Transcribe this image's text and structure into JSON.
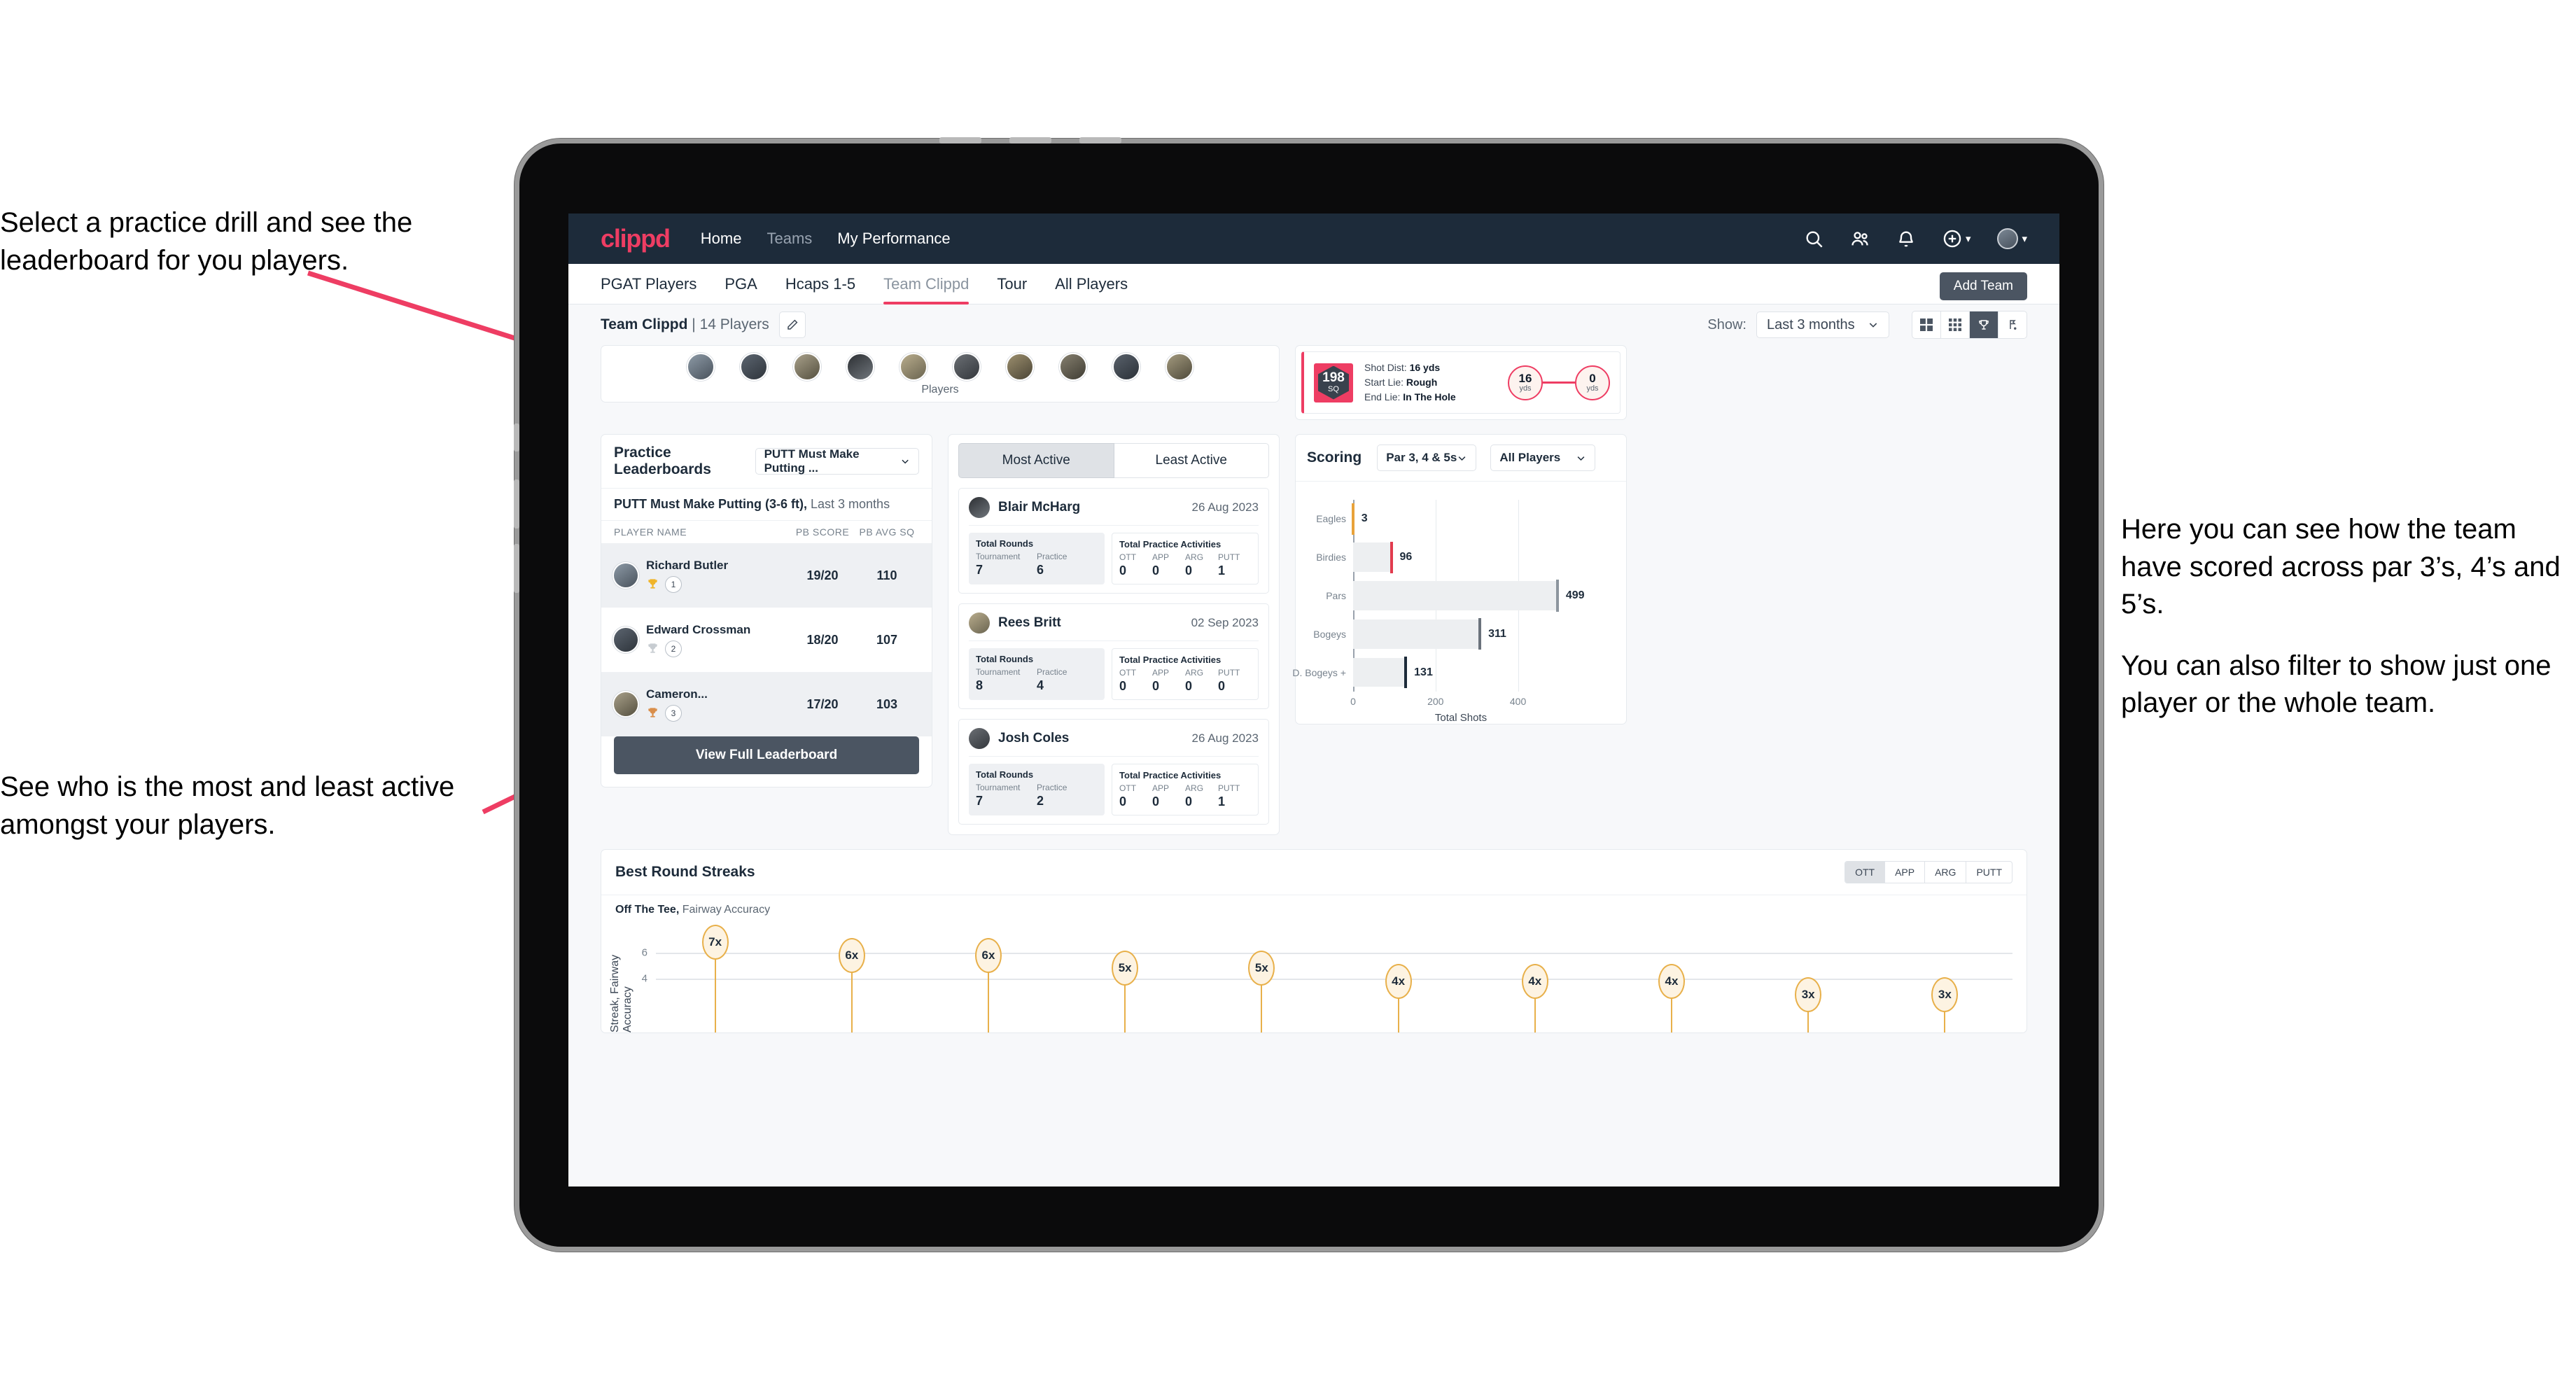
{
  "annotations": {
    "topleft": "Select a practice drill and see the leaderboard for you players.",
    "bottomleft": "See who is the most and least active amongst your players.",
    "right1": "Here you can see how the team have scored across par 3’s, 4’s and 5’s.",
    "right2": "You can also filter to show just one player or the whole team."
  },
  "nav": {
    "logo": "clippd",
    "links": [
      {
        "label": "Home",
        "dim": false
      },
      {
        "label": "Teams",
        "dim": true
      },
      {
        "label": "My Performance",
        "dim": false
      }
    ],
    "icons": [
      "search-icon",
      "people-icon",
      "bell-icon",
      "plus-circle-icon",
      "avatar"
    ]
  },
  "tabs": [
    {
      "label": "PGAT Players",
      "active": false,
      "dim": false
    },
    {
      "label": "PGA",
      "active": false,
      "dim": false
    },
    {
      "label": "Hcaps 1-5",
      "active": false,
      "dim": false
    },
    {
      "label": "Team Clippd",
      "active": true,
      "dim": true
    },
    {
      "label": "Tour",
      "active": false,
      "dim": false
    },
    {
      "label": "All Players",
      "active": false,
      "dim": false
    }
  ],
  "add_team_label": "Add Team",
  "subheader": {
    "team_label": "Team Clippd",
    "team_count": " | 14 Players",
    "edit_icon": "pencil-icon",
    "show_label": "Show:",
    "range_value": "Last 3 months",
    "view_buttons": [
      {
        "icon": "grid-large-icon",
        "on": false
      },
      {
        "icon": "grid-small-icon",
        "on": false
      },
      {
        "icon": "trophy-icon",
        "on": true
      },
      {
        "icon": "flag-icon",
        "on": false
      }
    ]
  },
  "players_strip": {
    "label": "Players",
    "count": 10
  },
  "shot_card": {
    "sq_value": "198",
    "sq_unit": "SQ",
    "rows": [
      {
        "label": "Shot Dist:",
        "value": "16 yds"
      },
      {
        "label": "Start Lie:",
        "value": "Rough"
      },
      {
        "label": "End Lie:",
        "value": "In The Hole"
      }
    ],
    "start": {
      "value": "16",
      "unit": "yds"
    },
    "end": {
      "value": "0",
      "unit": "yds"
    }
  },
  "leaderboard": {
    "title": "Practice Leaderboards",
    "drill_select": "PUTT Must Make Putting ...",
    "drill_title": "PUTT Must Make Putting (3-6 ft),",
    "drill_range": " Last 3 months",
    "columns": [
      "PLAYER NAME",
      "PB SCORE",
      "PB AVG SQ"
    ],
    "rows": [
      {
        "name": "Richard Butler",
        "rank": "1",
        "trophy": "gold",
        "pb_score": "19/20",
        "pb_avg_sq": "110"
      },
      {
        "name": "Edward Crossman",
        "rank": "2",
        "trophy": "silver",
        "pb_score": "18/20",
        "pb_avg_sq": "107"
      },
      {
        "name": "Cameron...",
        "rank": "3",
        "trophy": "bronze",
        "pb_score": "17/20",
        "pb_avg_sq": "103"
      }
    ],
    "button": "View Full Leaderboard"
  },
  "activity": {
    "tabs": [
      {
        "label": "Most Active",
        "active": true
      },
      {
        "label": "Least Active",
        "active": false
      }
    ],
    "rounds_title": "Total Rounds",
    "rounds_cols": [
      "Tournament",
      "Practice"
    ],
    "practice_title": "Total Practice Activities",
    "practice_cols": [
      "OTT",
      "APP",
      "ARG",
      "PUTT"
    ],
    "cards": [
      {
        "name": "Blair McHarg",
        "date": "26 Aug 2023",
        "tournament": "7",
        "practice": "6",
        "ott": "0",
        "app": "0",
        "arg": "0",
        "putt": "1"
      },
      {
        "name": "Rees Britt",
        "date": "02 Sep 2023",
        "tournament": "8",
        "practice": "4",
        "ott": "0",
        "app": "0",
        "arg": "0",
        "putt": "0"
      },
      {
        "name": "Josh Coles",
        "date": "26 Aug 2023",
        "tournament": "7",
        "practice": "2",
        "ott": "0",
        "app": "0",
        "arg": "0",
        "putt": "1"
      }
    ]
  },
  "scoring": {
    "title": "Scoring",
    "par_filter": "Par 3, 4 & 5s",
    "player_filter": "All Players"
  },
  "streaks": {
    "title": "Best Round Streaks",
    "tabs": [
      {
        "label": "OTT",
        "on": true
      },
      {
        "label": "APP",
        "on": false
      },
      {
        "label": "ARG",
        "on": false
      },
      {
        "label": "PUTT",
        "on": false
      }
    ],
    "subtitle_bold": "Off The Tee,",
    "subtitle_rest": " Fairway Accuracy"
  },
  "colors": {
    "accent": "#ee3d63",
    "nav_bg": "#1d2b3a",
    "dark_btn": "#4b5562",
    "gold": "#e8b04a",
    "page_bg": "#f7f8fa"
  },
  "chart_data": [
    {
      "type": "bar",
      "orientation": "horizontal",
      "title": "Scoring",
      "categories": [
        "Eagles",
        "Birdies",
        "Pars",
        "Bogeys",
        "D. Bogeys +"
      ],
      "values": [
        3,
        96,
        499,
        311,
        131
      ],
      "cap_colors": [
        "#e8a23a",
        "#e23b4e",
        "#8c959e",
        "#6b737c",
        "#1d2b3a"
      ],
      "xlabel": "Total Shots",
      "ylabel": "",
      "xlim": [
        0,
        540
      ],
      "xticks": [
        0,
        200,
        400
      ],
      "grid": true,
      "legend": "none"
    },
    {
      "type": "bar",
      "orientation": "vertical",
      "title": "Best Round Streaks",
      "subtitle": "Off The Tee, Fairway Accuracy",
      "ylabel": "Streak, Fairway Accuracy",
      "categories": [
        "1",
        "2",
        "3",
        "4",
        "5",
        "6",
        "7",
        "8",
        "9",
        "10"
      ],
      "values": [
        7,
        6,
        6,
        5,
        5,
        4,
        4,
        4,
        3,
        3
      ],
      "labels": [
        "7x",
        "6x",
        "6x",
        "5x",
        "5x",
        "4x",
        "4x",
        "4x",
        "3x",
        "3x"
      ],
      "yticks": [
        4,
        6
      ],
      "ylim": [
        0,
        8
      ],
      "grid": true,
      "legend": "none"
    }
  ]
}
